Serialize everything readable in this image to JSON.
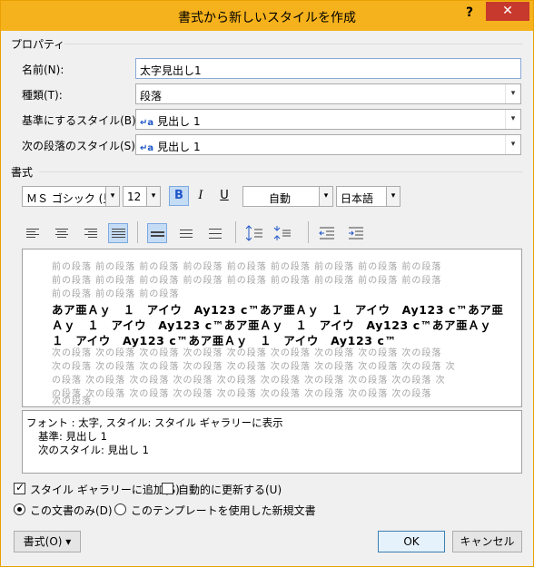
{
  "window": {
    "title": "書式から新しいスタイルを作成",
    "help_label": "?",
    "close_label": "✕"
  },
  "properties": {
    "section_label": "プロパティ",
    "name_label": "名前(N):",
    "name_value": "太字見出し1",
    "type_label": "種類(T):",
    "type_value": "段落",
    "based_on_label": "基準にするスタイル(B):",
    "based_on_value": "見出し 1",
    "next_label": "次の段落のスタイル(S):",
    "next_value": "見出し 1",
    "style_icon": "↵a"
  },
  "format": {
    "section_label": "書式",
    "font_value": "ＭＳ ゴシック (見出",
    "size_value": "12",
    "bold_label": "B",
    "italic_label": "I",
    "underline_label": "U",
    "color_value": "自動",
    "language_value": "日本語"
  },
  "preview": {
    "prev_lines": [
      "前の段落 前の段落 前の段落 前の段落 前の段落 前の段落 前の段落 前の段落 前の段落",
      "前の段落 前の段落 前の段落 前の段落 前の段落 前の段落 前の段落 前の段落 前の段落",
      "前の段落 前の段落 前の段落"
    ],
    "sample_lines": [
      "あア亜Ａｙ　１　アイウ　Ay123 c™あア亜Ａｙ　１　アイウ　Ay123 c™あア亜",
      "Ａｙ　１　アイウ　Ay123 c™あア亜Ａｙ　１　アイウ　Ay123 c™あア亜Ａｙ",
      "１　アイウ　Ay123 c™あア亜Ａｙ　１　アイウ　Ay123 c™"
    ],
    "next_lines": [
      "次の段落 次の段落 次の段落 次の段落 次の段落 次の段落 次の段落 次の段落 次の段落",
      "次の段落 次の段落 次の段落 次の段落 次の段落 次の段落 次の段落 次の段落 次の段落 次",
      "の段落 次の段落 次の段落 次の段落 次の段落 次の段落 次の段落 次の段落 次の段落 次",
      "の段落 次の段落 次の段落 次の段落 次の段落 次の段落 次の段落 次の段落 次の段落",
      "次の段落"
    ]
  },
  "description": {
    "line1": "フォント : 太字, スタイル: スタイル ギャラリーに表示",
    "line2": "基準: 見出し 1",
    "line3": "次のスタイル: 見出し 1"
  },
  "options": {
    "add_to_gallery_label": "スタイル ギャラリーに追加(S)",
    "add_to_gallery_checked": true,
    "auto_update_label": "自動的に更新する(U)",
    "auto_update_checked": false,
    "this_doc_label": "この文書のみ(D)",
    "template_label": "このテンプレートを使用した新規文書",
    "selected_scope": "this_doc"
  },
  "buttons": {
    "format_label": "書式(O) ▾",
    "ok_label": "OK",
    "cancel_label": "キャンセル"
  },
  "colors": {
    "titlebar": "#f6b21c",
    "close": "#c7392c",
    "style_icon": "#1f56c7",
    "active_button": "#c5dcf5"
  }
}
